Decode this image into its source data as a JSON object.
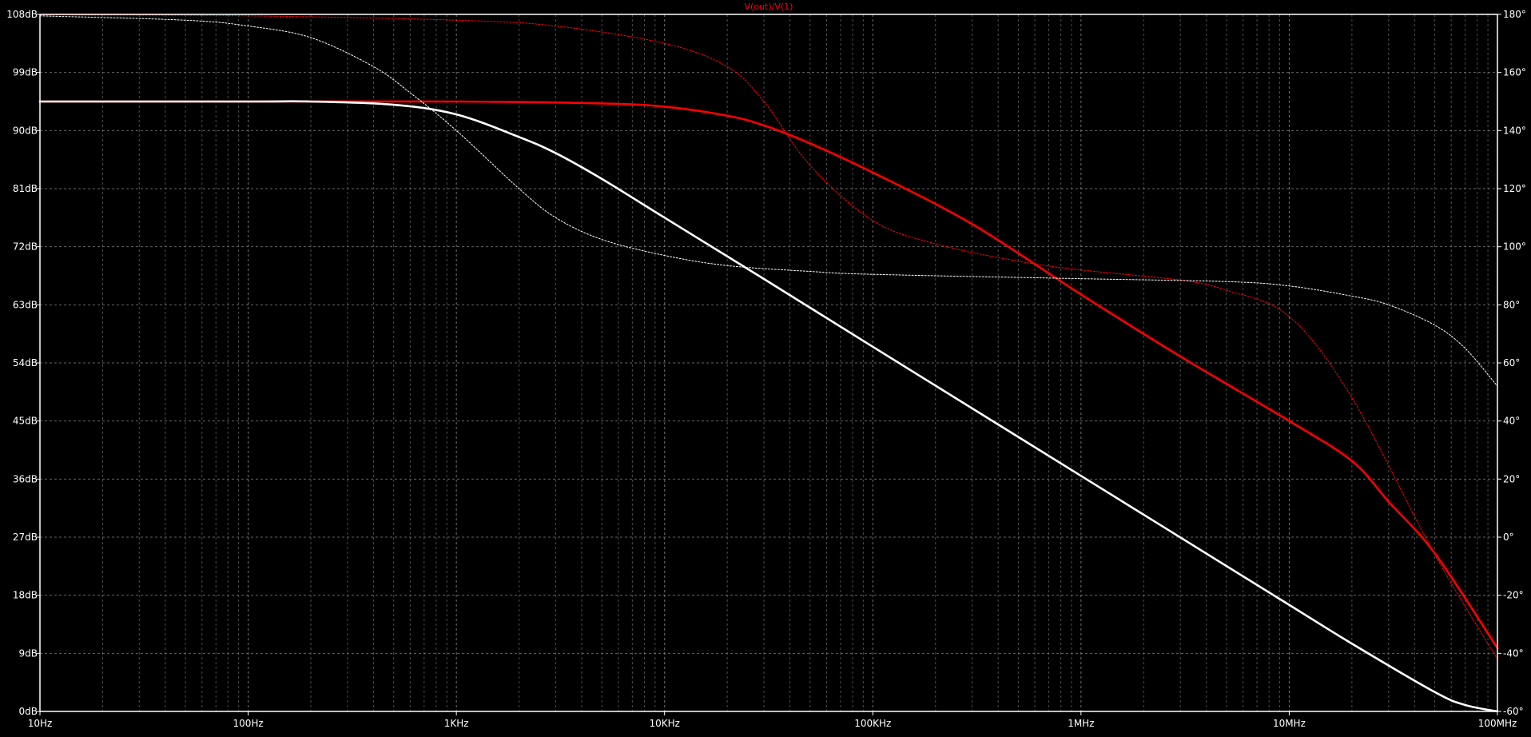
{
  "chart_data": {
    "type": "line",
    "title": "V(out)/V(1)",
    "x_scale": "log",
    "xlim": [
      10,
      100000000
    ],
    "ylim_left": [
      0,
      108
    ],
    "ylim_right": [
      -60,
      180
    ],
    "grid": true,
    "x_ticks": [
      {
        "value": 10,
        "label": "10Hz"
      },
      {
        "value": 100,
        "label": "100Hz"
      },
      {
        "value": 1000,
        "label": "1KHz"
      },
      {
        "value": 10000,
        "label": "10KHz"
      },
      {
        "value": 100000,
        "label": "100KHz"
      },
      {
        "value": 1000000,
        "label": "1MHz"
      },
      {
        "value": 10000000,
        "label": "10MHz"
      },
      {
        "value": 100000000,
        "label": "100MHz"
      }
    ],
    "y_left_ticks": [
      {
        "value": 0,
        "label": "0dB"
      },
      {
        "value": 9,
        "label": "9dB"
      },
      {
        "value": 18,
        "label": "18dB"
      },
      {
        "value": 27,
        "label": "27dB"
      },
      {
        "value": 36,
        "label": "36dB"
      },
      {
        "value": 45,
        "label": "45dB"
      },
      {
        "value": 54,
        "label": "54dB"
      },
      {
        "value": 63,
        "label": "63dB"
      },
      {
        "value": 72,
        "label": "72dB"
      },
      {
        "value": 81,
        "label": "81dB"
      },
      {
        "value": 90,
        "label": "90dB"
      },
      {
        "value": 99,
        "label": "99dB"
      },
      {
        "value": 108,
        "label": "108dB"
      }
    ],
    "y_right_ticks": [
      {
        "value": -60,
        "label": "-60°"
      },
      {
        "value": -40,
        "label": "-40°"
      },
      {
        "value": -20,
        "label": "-20°"
      },
      {
        "value": 0,
        "label": "0°"
      },
      {
        "value": 20,
        "label": "20°"
      },
      {
        "value": 40,
        "label": "40°"
      },
      {
        "value": 60,
        "label": "60°"
      },
      {
        "value": 80,
        "label": "80°"
      },
      {
        "value": 100,
        "label": "100°"
      },
      {
        "value": 120,
        "label": "120°"
      },
      {
        "value": 140,
        "label": "140°"
      },
      {
        "value": 160,
        "label": "160°"
      },
      {
        "value": 180,
        "label": "180°"
      }
    ],
    "colors": {
      "background": "#000000",
      "axis": "#ffffff",
      "grid": "#808080",
      "title": "#ff0000"
    },
    "series": [
      {
        "axis": "left",
        "kind": "magnitude",
        "color": "#ff0000",
        "style": "solid",
        "x": [
          10,
          100,
          1000,
          5000,
          10000,
          20000,
          30000,
          50000,
          100000,
          300000,
          1000000,
          3000000,
          10000000,
          20000000,
          30000000,
          50000000,
          100000000
        ],
        "y": [
          94.5,
          94.5,
          94.5,
          94.2,
          93.7,
          92.3,
          90.8,
          88.0,
          83.5,
          75.5,
          64.6,
          55.0,
          45.0,
          38.8,
          32.5,
          24.5,
          9.8
        ]
      },
      {
        "axis": "right",
        "kind": "phase",
        "color": "#ff0000",
        "style": "dashed",
        "x": [
          10,
          100,
          1000,
          3000,
          10000,
          20000,
          30000,
          50000,
          100000,
          200000,
          500000,
          1000000,
          3000000,
          5000000,
          10000000,
          20000000,
          50000000,
          100000000
        ],
        "y": [
          179.8,
          179.5,
          178.0,
          176.0,
          170.0,
          162.0,
          150.0,
          128.0,
          109.0,
          101.0,
          95.0,
          92.0,
          88.5,
          85.0,
          76.0,
          48.0,
          -6.0,
          -42.0
        ]
      },
      {
        "axis": "left",
        "kind": "magnitude",
        "color": "#ffffff",
        "style": "solid",
        "x": [
          10,
          100,
          200,
          500,
          1000,
          2000,
          3000,
          5000,
          10000,
          30000,
          100000,
          1000000,
          10000000,
          20000000,
          50000000,
          70000000,
          100000000
        ],
        "y": [
          94.5,
          94.5,
          94.5,
          94.0,
          92.5,
          89.0,
          86.5,
          82.5,
          76.5,
          67.0,
          56.5,
          36.5,
          16.5,
          10.5,
          3.0,
          1.0,
          0.0
        ]
      },
      {
        "axis": "right",
        "kind": "phase",
        "color": "#ffffff",
        "style": "dashed",
        "x": [
          10,
          50,
          100,
          200,
          400,
          600,
          1000,
          2000,
          3000,
          5000,
          10000,
          20000,
          50000,
          100000,
          1000000,
          5000000,
          10000000,
          20000000,
          30000000,
          50000000,
          70000000,
          100000000
        ],
        "y": [
          179.5,
          178.0,
          176.0,
          172.0,
          162.0,
          153.0,
          140.0,
          120.0,
          110.0,
          102.5,
          97.0,
          93.5,
          91.5,
          90.5,
          89.0,
          88.0,
          86.5,
          83.0,
          80.0,
          73.0,
          65.0,
          52.0
        ]
      }
    ]
  }
}
